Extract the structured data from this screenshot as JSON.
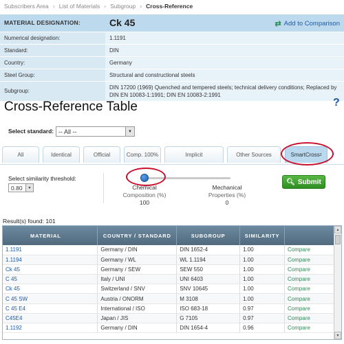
{
  "breadcrumb": [
    "Subscribers Area",
    "List of Materials",
    "Subgroup",
    "Cross-Reference"
  ],
  "material": {
    "designation_label": "MATERIAL DESIGNATION:",
    "designation_value": "Ck 45",
    "add_compare": "Add to Comparison",
    "rows": [
      {
        "label": "Numerical designation:",
        "value": "1.1191",
        "is_link": true
      },
      {
        "label": "Standard:",
        "value": "DIN"
      },
      {
        "label": "Country:",
        "value": "Germany"
      },
      {
        "label": "Steel Group:",
        "value": "Structural and constructional steels"
      },
      {
        "label": "Subgroup:",
        "value": "DIN 17200 (1969) Quenched and tempered steels; technical delivery conditions; Replaced by DIN EN 10083-1:1991; DIN EN 10083-2:1991"
      }
    ]
  },
  "title": "Cross-Reference Table",
  "help": "?",
  "standard": {
    "label": "Select standard:",
    "value": "-- All --"
  },
  "tabs": [
    "All",
    "Identical",
    "Official",
    "Comp. 100%",
    "Implicit",
    "Other Sources",
    "SmartCross"
  ],
  "tab_superscript": "2",
  "threshold": {
    "label": "Select similarity threshold:",
    "value": "0.80"
  },
  "slider": {
    "left_title": "Chemical",
    "left_sub": "Composition (%)",
    "left_value": "100",
    "right_title": "Mechanical",
    "right_sub": "Properties (%)",
    "right_value": "0",
    "position": 0
  },
  "submit": "Submit",
  "results_found": "Result(s) found: 101",
  "columns": [
    "MATERIAL",
    "COUNTRY / STANDARD",
    "SUBGROUP",
    "SIMILARITY",
    ""
  ],
  "rows": [
    {
      "material": "1.1191",
      "country": "Germany / DIN",
      "subgroup": "DIN 1652-4",
      "similarity": "1.00",
      "action": "Compare"
    },
    {
      "material": "1.1194",
      "country": "Germany / WL",
      "subgroup": "WL 1.1194",
      "similarity": "1.00",
      "action": "Compare"
    },
    {
      "material": "Ck 45",
      "country": "Germany / SEW",
      "subgroup": "SEW 550",
      "similarity": "1.00",
      "action": "Compare"
    },
    {
      "material": "C 45",
      "country": "Italy / UNI",
      "subgroup": "UNI 6403",
      "similarity": "1.00",
      "action": "Compare"
    },
    {
      "material": "Ck 45",
      "country": "Switzerland / SNV",
      "subgroup": "SNV 10645",
      "similarity": "1.00",
      "action": "Compare"
    },
    {
      "material": "C 45 SW",
      "country": "Austria / ONORM",
      "subgroup": "M 3108",
      "similarity": "1.00",
      "action": "Compare"
    },
    {
      "material": "C 45 E4",
      "country": "International / ISO",
      "subgroup": "ISO 683-18",
      "similarity": "0.97",
      "action": "Compare"
    },
    {
      "material": "C45E4",
      "country": "Japan / JIS",
      "subgroup": "G 7105",
      "similarity": "0.97",
      "action": "Compare"
    },
    {
      "material": "1.1192",
      "country": "Germany / DIN",
      "subgroup": "DIN 1654-4",
      "similarity": "0.96",
      "action": "Compare"
    }
  ]
}
